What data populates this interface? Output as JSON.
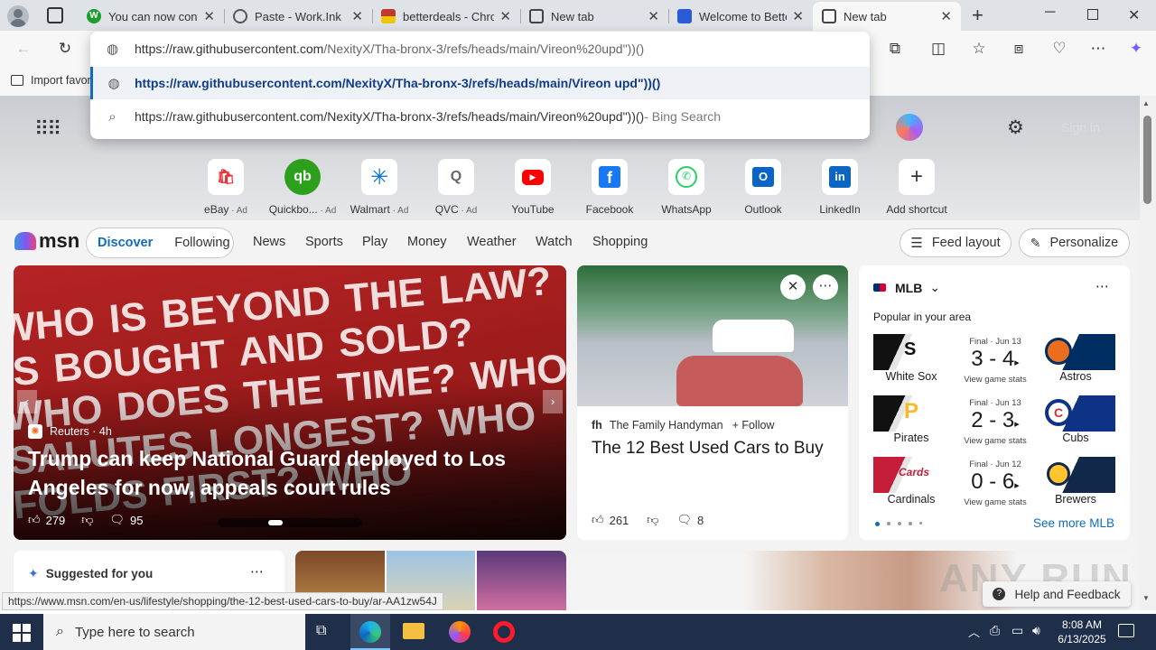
{
  "tabs": [
    {
      "title": "You can now conti",
      "favicon_color": "#1a9f29",
      "favicon": "W"
    },
    {
      "title": "Paste - Work.Ink",
      "favicon_color": "#666666",
      "favicon": "globe-icon"
    },
    {
      "title": "betterdeals - Chro",
      "favicon_color": "#c0392b",
      "favicon": "chrome-store-icon"
    },
    {
      "title": "New tab",
      "favicon_color": "#444444",
      "favicon": "newtab-icon"
    },
    {
      "title": "Welcome to Better",
      "favicon_color": "#2a5bd7",
      "favicon": "betterdeals-icon"
    },
    {
      "title": "New tab",
      "favicon_color": "#444444",
      "favicon": "newtab-icon"
    }
  ],
  "bookmarks_bar": {
    "import_label": "Import favor"
  },
  "omnibox": {
    "typed": "https://raw.githubusercontent.com/NexityX/Tha-bronx-3/refs/heads/main/Vireon%20upd\"))()",
    "typed_prefix": "https://raw.githubusercontent.com",
    "typed_rest": "/NexityX/Tha-bronx-3/refs/heads/main/Vireon%20upd\"))()",
    "suggestion_url": "https://raw.githubusercontent.com/NexityX/Tha-bronx-3/refs/heads/main/Vireon upd\"))()",
    "search_query": "https://raw.githubusercontent.com/NexityX/Tha-bronx-3/refs/heads/main/Vireon%20upd\"))()",
    "search_suffix": " - Bing Search"
  },
  "header": {
    "signin": "Sign in"
  },
  "shortcuts": [
    {
      "label": "eBay",
      "ad": " · Ad",
      "icon": "ebay-icon",
      "color": "#e53238"
    },
    {
      "label": "Quickbo...",
      "ad": " · Ad",
      "icon": "quickbooks-icon",
      "color": "#2ca01c"
    },
    {
      "label": "Walmart",
      "ad": " · Ad",
      "icon": "walmart-icon",
      "color": "#0071ce"
    },
    {
      "label": "QVC",
      "ad": " · Ad",
      "icon": "qvc-icon",
      "color": "#666666"
    },
    {
      "label": "YouTube",
      "ad": "",
      "icon": "youtube-icon",
      "color": "#ff0000"
    },
    {
      "label": "Facebook",
      "ad": "",
      "icon": "facebook-icon",
      "color": "#1877f2"
    },
    {
      "label": "WhatsApp",
      "ad": "",
      "icon": "whatsapp-icon",
      "color": "#25d366"
    },
    {
      "label": "Outlook",
      "ad": "",
      "icon": "outlook-icon",
      "color": "#0a64c8"
    },
    {
      "label": "LinkedIn",
      "ad": "",
      "icon": "linkedin-icon",
      "color": "#0a66c2"
    },
    {
      "label": "Add shortcut",
      "ad": "",
      "icon": "plus-icon",
      "color": "#333333"
    }
  ],
  "msn": {
    "logo": "msn",
    "tabs": [
      "Discover",
      "Following"
    ],
    "nav": [
      "News",
      "Sports",
      "Play",
      "Money",
      "Weather",
      "Watch",
      "Shopping"
    ],
    "feed_layout": "Feed layout",
    "personalize": "Personalize"
  },
  "hero": {
    "source": "Reuters",
    "age": "· 4h",
    "headline": "Trump can keep National Guard deployed to Los Angeles for now, appeals court rules",
    "likes": "279",
    "comments": "95",
    "bg_text": "WHO IS BEYOND THE LAW? IS BOUGHT AND SOLD? WHO DOES THE TIME? WHO SALUTES LONGEST? WHO FOLDS FIRST? WHO"
  },
  "article2": {
    "source": "The Family Handyman",
    "follow": "Follow",
    "headline": "The 12 Best Used Cars to Buy",
    "likes": "261",
    "comments": "8"
  },
  "mlb": {
    "title": "MLB",
    "subtitle": "Popular in your area",
    "games": [
      {
        "status": "Final · Jun 13",
        "score": "3 - 4",
        "home": "White Sox",
        "away": "Astros",
        "c1": "#111111",
        "c2": "#002d62"
      },
      {
        "status": "Final · Jun 13",
        "score": "2 - 3",
        "home": "Pirates",
        "away": "Cubs",
        "c1": "#111111",
        "c2": "#0e3386"
      },
      {
        "status": "Final · Jun 12",
        "score": "0 - 6",
        "home": "Cardinals",
        "away": "Brewers",
        "c1": "#c41e3a",
        "c2": "#12284b"
      }
    ],
    "view_stats": "View game stats",
    "see_more": "See more MLB"
  },
  "suggested": {
    "title": "Suggested for you"
  },
  "help": "Help and Feedback",
  "status_url": "https://www.msn.com/en-us/lifestyle/shopping/the-12-best-used-cars-to-buy/ar-AA1zw54J",
  "taskbar": {
    "search_placeholder": "Type here to search",
    "time": "8:08 AM",
    "date": "6/13/2025"
  },
  "watermark": "ANY RUN"
}
